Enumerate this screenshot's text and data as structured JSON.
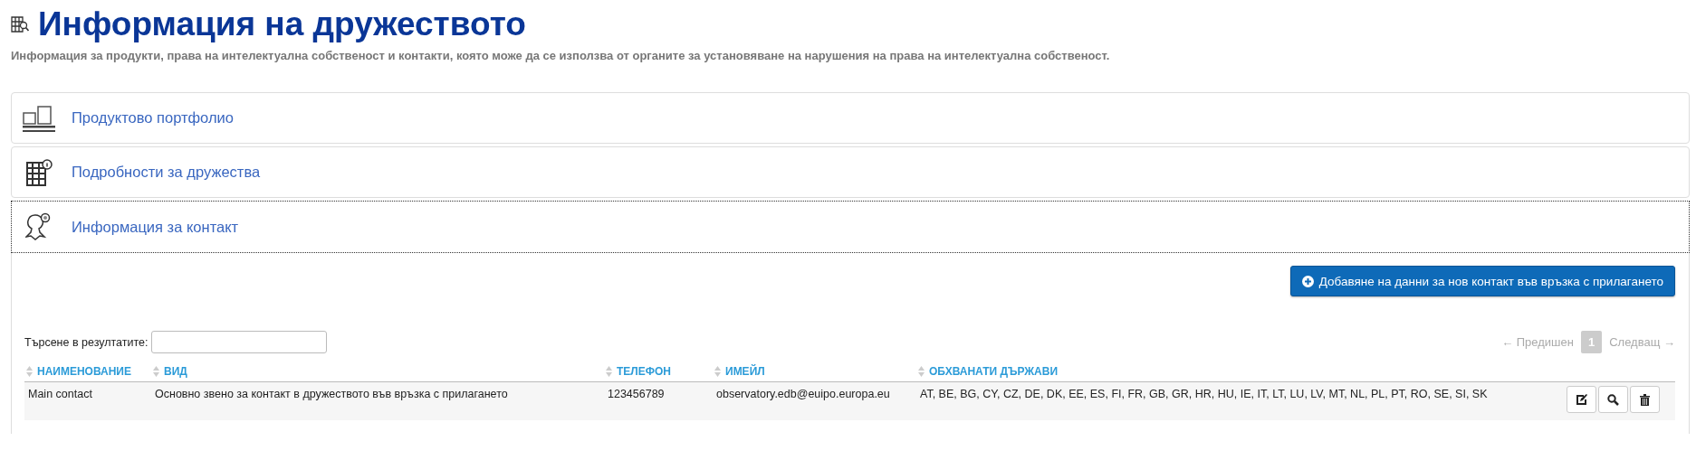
{
  "page": {
    "title": "Информация на дружеството",
    "subtitle": "Информация за продукти, права на интелектуална собственост и контакти, която може да се използва от органите за установяване на нарушения на права на интелектуална собственост."
  },
  "sections": [
    {
      "kind": "portfolio",
      "title": "Продуктово портфолио",
      "focused": false
    },
    {
      "kind": "company",
      "title": "Подробности за дружества",
      "focused": false
    },
    {
      "kind": "contact",
      "title": "Информация за контакт",
      "focused": true
    }
  ],
  "add_button": {
    "label": "Добавяне на данни за нов контакт във връзка с прилагането"
  },
  "search": {
    "label": "Търсене в резултатите:"
  },
  "pagination": {
    "previous": "← Предишен",
    "pages": [
      {
        "label": "1",
        "selected": true
      }
    ],
    "next": "Следващ →"
  },
  "table": {
    "columns": [
      "НАИМЕНОВАНИЕ",
      "ВИД",
      "ТЕЛЕФОН",
      "ИМЕЙЛ",
      "ОБХВАНАТИ ДЪРЖАВИ"
    ],
    "rows": [
      {
        "cells": [
          "Main contact",
          "Основно звено за контакт в дружеството във връзка с прилагането",
          "123456789",
          "observatory.edb@euipo.europa.eu",
          "AT, BE, BG, CY, CZ, DE, DK, EE, ES, FI, FR, GB, GR, HR, HU, IE, IT, LT, LU, LV, MT, NL, PL, PT, RO, SE, SI, SK"
        ]
      }
    ]
  }
}
